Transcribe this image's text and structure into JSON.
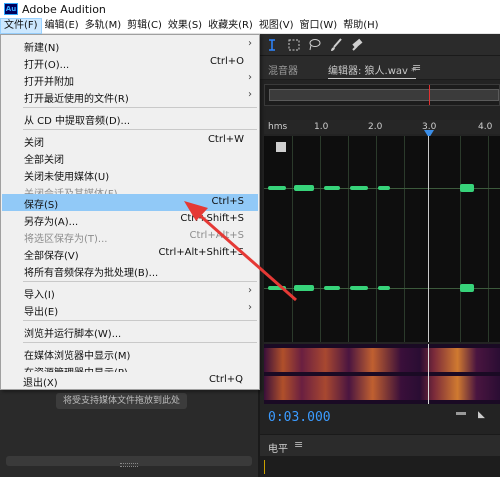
{
  "window": {
    "title": "Adobe Audition",
    "app_icon_text": "Au"
  },
  "menubar": {
    "items": [
      {
        "label": "文件(F)"
      },
      {
        "label": "编辑(E)"
      },
      {
        "label": "多轨(M)"
      },
      {
        "label": "剪辑(C)"
      },
      {
        "label": "效果(S)"
      },
      {
        "label": "收藏夹(R)"
      },
      {
        "label": "视图(V)"
      },
      {
        "label": "窗口(W)"
      },
      {
        "label": "帮助(H)"
      }
    ]
  },
  "file_menu": {
    "items": [
      {
        "label": "新建(N)",
        "shortcut": "",
        "submenu": true
      },
      {
        "label": "打开(O)...",
        "shortcut": "Ctrl+O"
      },
      {
        "label": "打开并附加",
        "shortcut": "",
        "submenu": true
      },
      {
        "label": "打开最近使用的文件(R)",
        "shortcut": "",
        "submenu": true
      },
      {
        "label": "从 CD 中提取音频(D)...",
        "shortcut": ""
      },
      {
        "label": "关闭",
        "shortcut": "Ctrl+W"
      },
      {
        "label": "全部关闭",
        "shortcut": ""
      },
      {
        "label": "关闭未使用媒体(U)",
        "shortcut": ""
      },
      {
        "label": "关闭会话及其媒体(F)",
        "shortcut": "",
        "disabled": true
      },
      {
        "label": "保存(S)",
        "shortcut": "Ctrl+S",
        "highlighted": true
      },
      {
        "label": "另存为(A)...",
        "shortcut": "Ctrl+Shift+S"
      },
      {
        "label": "将选区保存为(T)...",
        "shortcut": "Ctrl+Alt+S",
        "disabled": true
      },
      {
        "label": "全部保存(V)",
        "shortcut": "Ctrl+Alt+Shift+S"
      },
      {
        "label": "将所有音频保存为批处理(B)...",
        "shortcut": ""
      },
      {
        "label": "导入(I)",
        "shortcut": "",
        "submenu": true
      },
      {
        "label": "导出(E)",
        "shortcut": "",
        "submenu": true
      },
      {
        "label": "浏览并运行脚本(W)...",
        "shortcut": ""
      },
      {
        "label": "在媒体浏览器中显示(M)",
        "shortcut": ""
      },
      {
        "label": "在资源管理器中显示(P)",
        "shortcut": ""
      },
      {
        "label": "退出(X)",
        "shortcut": "Ctrl+Q"
      }
    ],
    "submenu_arrow": "›"
  },
  "panels": {
    "mixer_tab": "混音器",
    "editor_tab": "编辑器: 狼人.wav *",
    "panel_menu_glyph": "≡"
  },
  "ruler": {
    "unit": "hms",
    "ticks": [
      "1.0",
      "2.0",
      "3.0",
      "4.0"
    ]
  },
  "time_display": "0:03.000",
  "level_panel": {
    "label": "电平",
    "menu_glyph": "≡"
  },
  "media_panel": {
    "drop_hint": "将受支持媒体文件拖放到此处"
  },
  "colors": {
    "highlight": "#91c9f7",
    "waveform": "#37d37a",
    "playhead_red": "#e23030",
    "time_blue": "#3b9bff",
    "annotation_arrow": "#e53935"
  },
  "icons": [
    "time-selection-icon",
    "marquee-icon",
    "lasso-icon",
    "brush-icon",
    "spot-healing-icon"
  ]
}
